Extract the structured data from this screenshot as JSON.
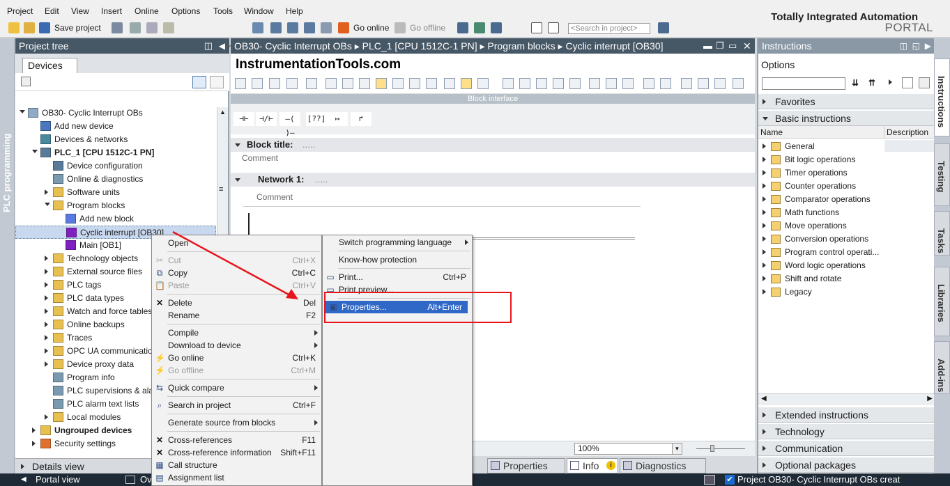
{
  "menubar": [
    "Project",
    "Edit",
    "View",
    "Insert",
    "Online",
    "Options",
    "Tools",
    "Window",
    "Help"
  ],
  "toolbar": {
    "save_project": "Save project",
    "go_online": "Go online",
    "go_offline": "Go offline",
    "search_placeholder": "<Search in project>"
  },
  "brand": {
    "line1": "Totally Integrated Automation",
    "line2": "PORTAL"
  },
  "left_vertical_tab": "PLC programming",
  "project_tree": {
    "header": "Project tree",
    "tab": "Devices",
    "items": [
      {
        "label": "OB30- Cyclic Interrupt OBs",
        "indent": 0,
        "toggle": "open"
      },
      {
        "label": "Add new device",
        "indent": 1,
        "toggle": "none"
      },
      {
        "label": "Devices & networks",
        "indent": 1,
        "toggle": "none"
      },
      {
        "label": "PLC_1 [CPU 1512C-1 PN]",
        "indent": 1,
        "toggle": "open"
      },
      {
        "label": "Device configuration",
        "indent": 2,
        "toggle": "none"
      },
      {
        "label": "Online & diagnostics",
        "indent": 2,
        "toggle": "none"
      },
      {
        "label": "Software units",
        "indent": 2,
        "toggle": "closed"
      },
      {
        "label": "Program blocks",
        "indent": 2,
        "toggle": "open"
      },
      {
        "label": "Add new block",
        "indent": 3,
        "toggle": "none"
      },
      {
        "label": "Cyclic interrupt [OB30]",
        "indent": 3,
        "toggle": "none",
        "selected": true
      },
      {
        "label": "Main [OB1]",
        "indent": 3,
        "toggle": "none"
      },
      {
        "label": "Technology objects",
        "indent": 2,
        "toggle": "closed"
      },
      {
        "label": "External source files",
        "indent": 2,
        "toggle": "closed"
      },
      {
        "label": "PLC tags",
        "indent": 2,
        "toggle": "closed"
      },
      {
        "label": "PLC data types",
        "indent": 2,
        "toggle": "closed"
      },
      {
        "label": "Watch and force tables",
        "indent": 2,
        "toggle": "closed"
      },
      {
        "label": "Online backups",
        "indent": 2,
        "toggle": "closed"
      },
      {
        "label": "Traces",
        "indent": 2,
        "toggle": "closed"
      },
      {
        "label": "OPC UA communication",
        "indent": 2,
        "toggle": "closed"
      },
      {
        "label": "Device proxy data",
        "indent": 2,
        "toggle": "closed"
      },
      {
        "label": "Program info",
        "indent": 2,
        "toggle": "none"
      },
      {
        "label": "PLC supervisions & alarms",
        "indent": 2,
        "toggle": "none"
      },
      {
        "label": "PLC alarm text lists",
        "indent": 2,
        "toggle": "none"
      },
      {
        "label": "Local modules",
        "indent": 2,
        "toggle": "closed"
      },
      {
        "label": "Ungrouped devices",
        "indent": 1,
        "toggle": "closed"
      },
      {
        "label": "Security settings",
        "indent": 1,
        "toggle": "closed"
      }
    ],
    "details_view": "Details view"
  },
  "editor": {
    "breadcrumb": "OB30- Cyclic Interrupt OBs  ▸  PLC_1 [CPU 1512C-1 PN]  ▸  Program blocks  ▸  Cyclic interrupt [OB30]",
    "watermark": "InstrumentationTools.com",
    "block_interface": "Block interface",
    "block_title": "Block title:",
    "block_title_dots": ".....",
    "comment": "Comment",
    "network1": "Network 1:",
    "network1_dots": ".....",
    "zoom": "100%",
    "ladder_elements": [
      "⊣⊢",
      "⊣/⊢",
      "–( )–",
      "[??]",
      "↦",
      "↱"
    ]
  },
  "bottom_tabs": {
    "properties": "Properties",
    "info": "Info",
    "diagnostics": "Diagnostics"
  },
  "context_menu": [
    {
      "label": "Open",
      "shortcut": "",
      "disabled": false,
      "icon": "",
      "sub": false
    },
    {
      "sep": true
    },
    {
      "label": "Cut",
      "shortcut": "Ctrl+X",
      "disabled": true,
      "icon": "scissors-icon",
      "sub": false
    },
    {
      "label": "Copy",
      "shortcut": "Ctrl+C",
      "disabled": false,
      "icon": "copy-icon",
      "sub": false
    },
    {
      "label": "Paste",
      "shortcut": "Ctrl+V",
      "disabled": true,
      "icon": "paste-icon",
      "sub": false
    },
    {
      "sep": true
    },
    {
      "label": "Delete",
      "shortcut": "Del",
      "disabled": false,
      "icon": "delete-icon",
      "sub": false
    },
    {
      "label": "Rename",
      "shortcut": "F2",
      "disabled": false,
      "icon": "",
      "sub": false
    },
    {
      "sep": true
    },
    {
      "label": "Compile",
      "shortcut": "",
      "disabled": false,
      "icon": "",
      "sub": true
    },
    {
      "label": "Download to device",
      "shortcut": "",
      "disabled": false,
      "icon": "",
      "sub": true
    },
    {
      "label": "Go online",
      "shortcut": "Ctrl+K",
      "disabled": false,
      "icon": "go-online-icon",
      "sub": false
    },
    {
      "label": "Go offline",
      "shortcut": "Ctrl+M",
      "disabled": true,
      "icon": "go-offline-icon",
      "sub": false
    },
    {
      "sep": true
    },
    {
      "label": "Quick compare",
      "shortcut": "",
      "disabled": false,
      "icon": "compare-icon",
      "sub": true
    },
    {
      "sep": true
    },
    {
      "label": "Search in project",
      "shortcut": "Ctrl+F",
      "disabled": false,
      "icon": "search-icon",
      "sub": false
    },
    {
      "sep": true
    },
    {
      "label": "Generate source from blocks",
      "shortcut": "",
      "disabled": false,
      "icon": "",
      "sub": true
    },
    {
      "sep": true
    },
    {
      "label": "Cross-references",
      "shortcut": "F11",
      "disabled": false,
      "icon": "cross-ref-icon",
      "sub": false
    },
    {
      "label": "Cross-reference information",
      "shortcut": "Shift+F11",
      "disabled": false,
      "icon": "cross-ref-info-icon",
      "sub": false
    },
    {
      "label": "Call structure",
      "shortcut": "",
      "disabled": false,
      "icon": "call-structure-icon",
      "sub": false
    },
    {
      "label": "Assignment list",
      "shortcut": "",
      "disabled": false,
      "icon": "assignment-list-icon",
      "sub": false
    }
  ],
  "context_menu2": [
    {
      "label": "Switch programming language",
      "shortcut": "",
      "sub": true,
      "icon": ""
    },
    {
      "sep": true
    },
    {
      "label": "Know-how protection",
      "shortcut": "",
      "sub": false,
      "icon": ""
    },
    {
      "sep": true
    },
    {
      "label": "Print...",
      "shortcut": "Ctrl+P",
      "sub": false,
      "icon": "print-icon"
    },
    {
      "label": "Print preview...",
      "shortcut": "",
      "sub": false,
      "icon": "print-preview-icon"
    },
    {
      "sep": true
    },
    {
      "label": "Properties...",
      "shortcut": "Alt+Enter",
      "sub": false,
      "icon": "properties-icon",
      "highlight": true
    }
  ],
  "instructions": {
    "header": "Instructions",
    "options": "Options",
    "favorites": "Favorites",
    "basic": "Basic instructions",
    "col_name": "Name",
    "col_desc": "Description",
    "items": [
      "General",
      "Bit logic operations",
      "Timer operations",
      "Counter operations",
      "Comparator operations",
      "Math functions",
      "Move operations",
      "Conversion operations",
      "Program control operati...",
      "Word logic operations",
      "Shift and rotate",
      "Legacy"
    ],
    "extended": "Extended instructions",
    "technology": "Technology",
    "communication": "Communication",
    "optional": "Optional packages"
  },
  "right_tabs": [
    "Instructions",
    "Testing",
    "Tasks",
    "Libraries",
    "Add-ins"
  ],
  "status": {
    "portal_view": "Portal view",
    "overview": "Ov",
    "message": "Project OB30- Cyclic Interrupt OBs creat"
  },
  "colors": {
    "header_bg": "#465766",
    "highlight": "#3068c8",
    "red_annotation": "#e8141c"
  }
}
